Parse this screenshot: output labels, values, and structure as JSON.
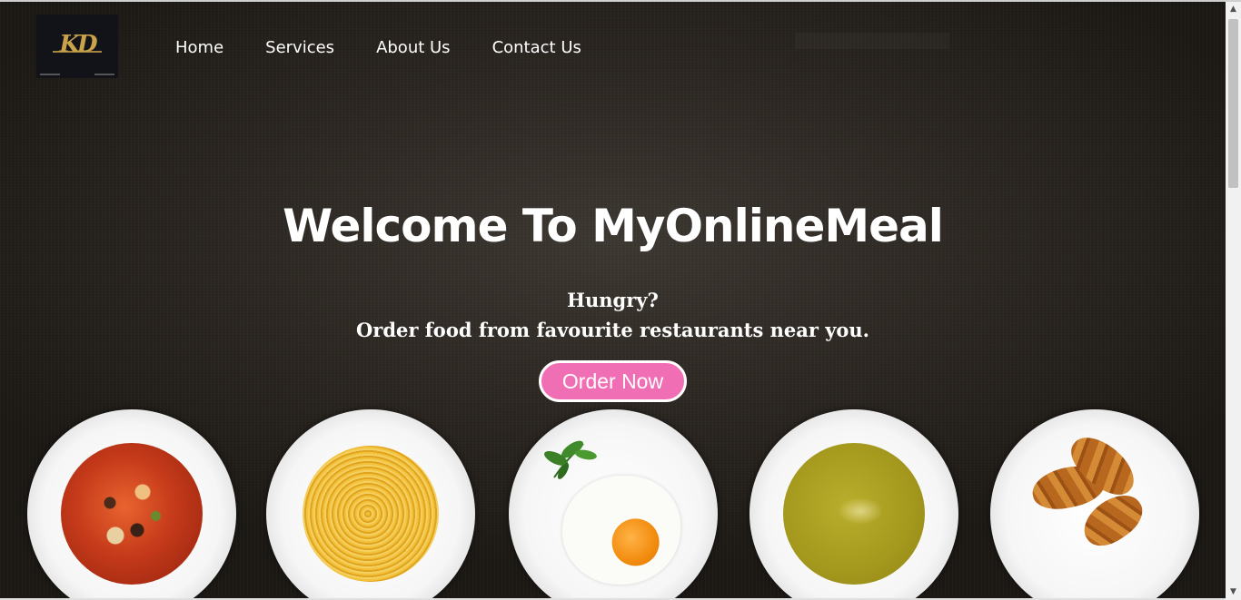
{
  "brand": {
    "logo_text": "KD"
  },
  "nav": {
    "items": [
      {
        "label": "Home"
      },
      {
        "label": "Services"
      },
      {
        "label": "About Us"
      },
      {
        "label": "Contact Us"
      }
    ]
  },
  "hero": {
    "title": "Welcome To MyOnlineMeal",
    "tagline_1": "Hungry?",
    "tagline_2": "Order food from favourite restaurants near you.",
    "cta_label": "Order Now"
  },
  "dishes": [
    {
      "icon": "minestrone-soup-plate"
    },
    {
      "icon": "spaghetti-plate"
    },
    {
      "icon": "fried-egg-plate"
    },
    {
      "icon": "pea-soup-plate"
    },
    {
      "icon": "croissant-plate"
    }
  ],
  "colors": {
    "accent": "#f06eb4",
    "background": "#2b2621",
    "text": "#ffffff"
  }
}
